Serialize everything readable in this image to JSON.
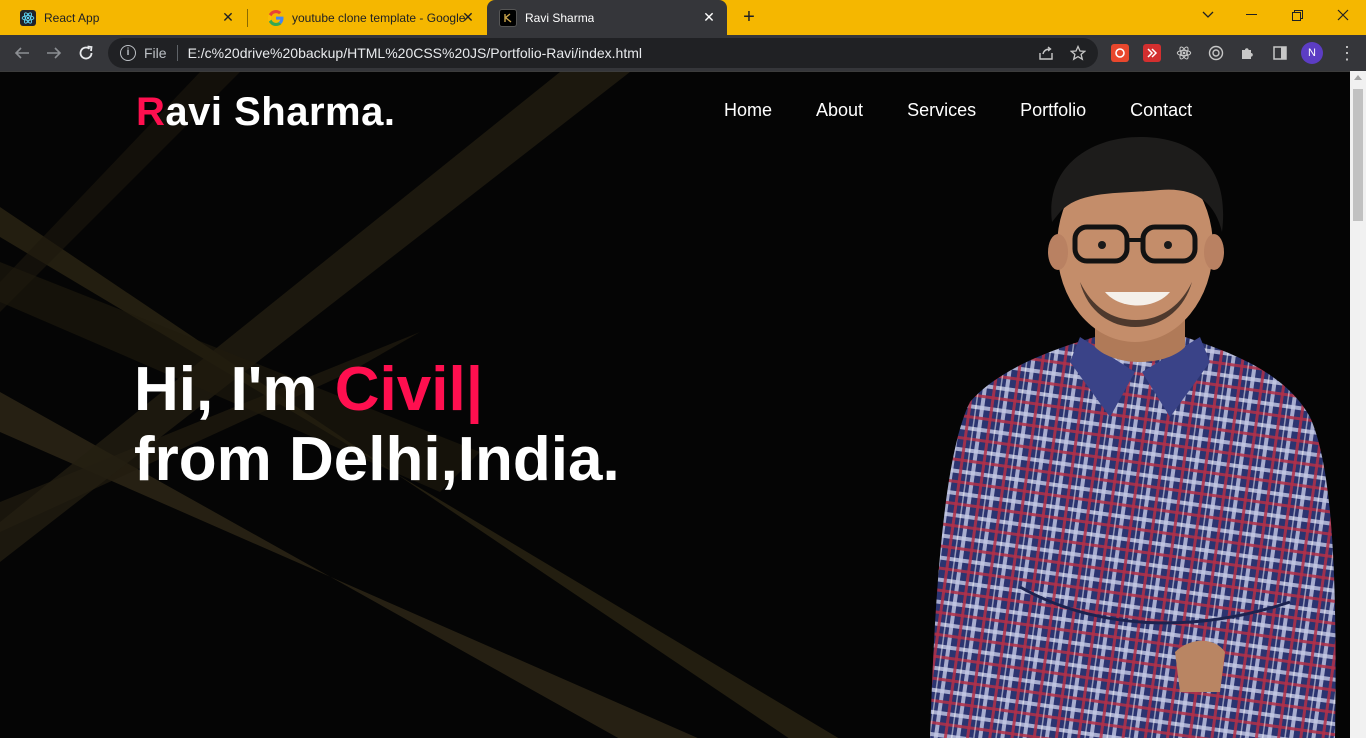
{
  "browser": {
    "tabs": [
      {
        "title": "React App",
        "icon": "react-icon",
        "active": false
      },
      {
        "title": "youtube clone template - Google",
        "icon": "google-icon",
        "active": false
      },
      {
        "title": "Ravi Sharma",
        "icon": "site-favicon-icon",
        "active": true
      }
    ],
    "address": {
      "scheme_label": "File",
      "url": "E:/c%20drive%20backup/HTML%20CSS%20JS/Portfolio-Ravi/index.html"
    },
    "profile_initial": "N",
    "accent_color": "#f5b700"
  },
  "page": {
    "logo": {
      "first_letter": "R",
      "rest": "avi Sharma."
    },
    "nav": [
      "Home",
      "About",
      "Services",
      "Portfolio",
      "Contact"
    ],
    "hero": {
      "line1_prefix": "Hi, I'm ",
      "typed_word": "Civil|",
      "line2": "from Delhi,India."
    },
    "accent_color": "#ff0f4f"
  }
}
